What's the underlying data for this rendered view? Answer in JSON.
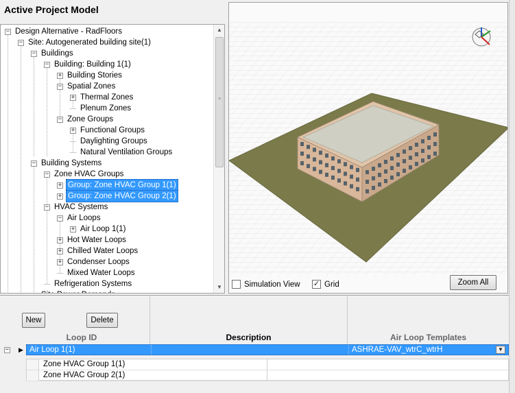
{
  "panel": {
    "title": "Active Project Model"
  },
  "tree": {
    "nodes": [
      {
        "label": "Design Alternative - RadFloors",
        "expander": "−"
      },
      {
        "label": "Site: Autogenerated building site(1)",
        "expander": "−"
      },
      {
        "label": "Buildings",
        "expander": "−"
      },
      {
        "label": "Building: Building  1(1)",
        "expander": "−"
      },
      {
        "label": "Building Stories",
        "expander": "+"
      },
      {
        "label": "Spatial Zones",
        "expander": "−"
      },
      {
        "label": "Thermal Zones",
        "expander": "+"
      },
      {
        "label": "Plenum Zones",
        "expander": ""
      },
      {
        "label": "Zone Groups",
        "expander": "−"
      },
      {
        "label": "Functional Groups",
        "expander": "+"
      },
      {
        "label": "Daylighting Groups",
        "expander": ""
      },
      {
        "label": "Natural Ventilation Groups",
        "expander": ""
      },
      {
        "label": "Building Systems",
        "expander": "−"
      },
      {
        "label": "Zone HVAC Groups",
        "expander": "−"
      },
      {
        "label": "Group: Zone HVAC Group  1(1)",
        "expander": "+"
      },
      {
        "label": "Group: Zone HVAC Group  2(1)",
        "expander": "+"
      },
      {
        "label": "HVAC Systems",
        "expander": "−"
      },
      {
        "label": "Air Loops",
        "expander": "−"
      },
      {
        "label": "Air Loop  1(1)",
        "expander": "+"
      },
      {
        "label": "Hot Water Loops",
        "expander": "+"
      },
      {
        "label": "Chilled Water Loops",
        "expander": "+"
      },
      {
        "label": "Condenser Loops",
        "expander": "+"
      },
      {
        "label": "Mixed Water Loops",
        "expander": ""
      },
      {
        "label": "Refrigeration Systems",
        "expander": ""
      },
      {
        "label": "Site Power Demands",
        "expander": ""
      }
    ]
  },
  "viewport": {
    "simulation_view_label": "Simulation View",
    "simulation_view_checked": "",
    "grid_label": "Grid",
    "grid_checked": "✓",
    "zoom_all_label": "Zoom All"
  },
  "loops": {
    "new_label": "New",
    "delete_label": "Delete",
    "columns": {
      "loop_id": "Loop ID",
      "description": "Description",
      "templates": "Air Loop Templates"
    },
    "rows": [
      {
        "loop_id": "Air Loop  1(1)",
        "description": "",
        "template": "ASHRAE-VAV_wtrC_wtrH"
      }
    ],
    "children": [
      {
        "name": "Zone HVAC Group  1(1)"
      },
      {
        "name": "Zone HVAC Group  2(1)"
      }
    ]
  },
  "colors": {
    "selection": "#3399ff",
    "ground": "#7b7a4a",
    "roof": "#cfcfc4",
    "wall": "#d9b79a"
  }
}
